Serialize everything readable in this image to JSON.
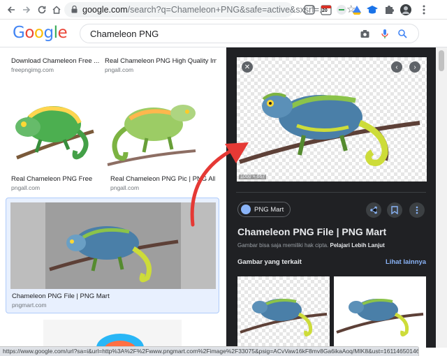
{
  "browser": {
    "url_host": "google.com",
    "url_rest": "/search?q=Chameleon+PNG&safe=active&sxsrf=..."
  },
  "icons": {
    "back": "arrow-left-icon",
    "forward": "arrow-right-icon",
    "reload": "reload-icon",
    "home": "home-icon",
    "lock": "lock-icon",
    "bookmark": "star-icon",
    "camera": "camera-icon",
    "mic": "microphone-icon",
    "search": "search-icon",
    "close": "close-icon",
    "share": "share-icon",
    "save": "bookmark-icon",
    "more": "more-vert-icon"
  },
  "extensions": {
    "badge": "20"
  },
  "google": {
    "logo": "Google",
    "query": "Chameleon PNG"
  },
  "results": [
    {
      "caption": "Download Chameleon Free ...",
      "source": "freepngimg.com"
    },
    {
      "caption": "Real Chameleon PNG High Quality Ima...",
      "source": "pngall.com"
    },
    {
      "caption": "Real Chameleon PNG Free D...",
      "source": "pngall.com"
    },
    {
      "caption": "Real Chameleon PNG Pic | PNG All",
      "source": "pngall.com"
    },
    {
      "caption": "Chameleon PNG File | PNG Mart",
      "source": "pngmart.com"
    }
  ],
  "panel": {
    "dimensions": "1000 × 667",
    "site_chip": "PNG Mart",
    "title": "Chameleon PNG File | PNG Mart",
    "notice": "Gambar bisa saja memiliki hak cipta.",
    "learn_more": "Pelajari Lebih Lanjut",
    "related_heading": "Gambar yang terkait",
    "see_all": "Lihat lainnya"
  },
  "status_url": "https://www.google.com/url?sa=i&url=http%3A%2F%2Fwww.pngmart.com%2Fimage%2F33075&psig=ACvVaw16kF8mv8Ga6ikaAoq/MIK8&ust=1611465014642...",
  "colors": {
    "accent": "#1a73e8",
    "panel_bg": "#202124",
    "link": "#8ab4f8",
    "arrow": "#e53935"
  }
}
